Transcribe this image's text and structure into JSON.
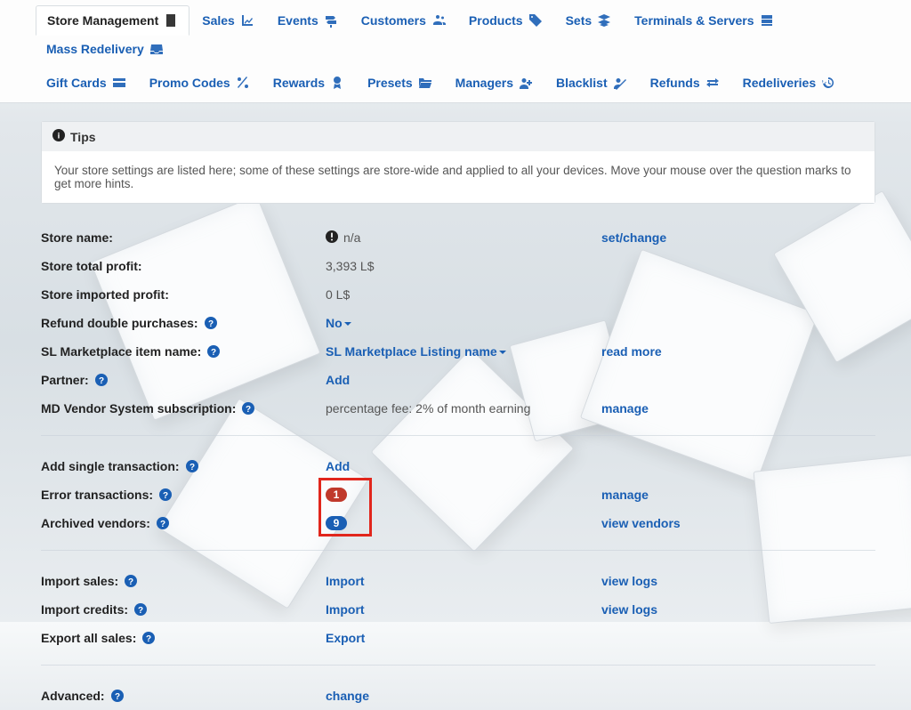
{
  "nav": {
    "row1": [
      {
        "label": "Store Management",
        "active": true
      },
      {
        "label": "Sales"
      },
      {
        "label": "Events"
      },
      {
        "label": "Customers"
      },
      {
        "label": "Products"
      },
      {
        "label": "Sets"
      },
      {
        "label": "Terminals & Servers"
      },
      {
        "label": "Mass Redelivery"
      }
    ],
    "row2": [
      {
        "label": "Gift Cards"
      },
      {
        "label": "Promo Codes"
      },
      {
        "label": "Rewards"
      },
      {
        "label": "Presets"
      },
      {
        "label": "Managers"
      },
      {
        "label": "Blacklist"
      },
      {
        "label": "Refunds"
      },
      {
        "label": "Redeliveries"
      }
    ]
  },
  "tips": {
    "title": "Tips",
    "body": "Your store settings are listed here; some of these settings are store-wide and applied to all your devices. Move your mouse over the question marks to get more hints."
  },
  "settings": {
    "store_name": {
      "label": "Store name:",
      "value": "n/a",
      "action": "set/change"
    },
    "store_total_profit": {
      "label": "Store total profit:",
      "value": "3,393 L$"
    },
    "store_imported_profit": {
      "label": "Store imported profit:",
      "value": "0 L$"
    },
    "refund_double": {
      "label": "Refund double purchases:",
      "value": "No"
    },
    "sl_marketplace": {
      "label": "SL Marketplace item name:",
      "value": "SL Marketplace Listing name",
      "action": "read more"
    },
    "partner": {
      "label": "Partner:",
      "value": "Add"
    },
    "subscription": {
      "label": "MD Vendor System subscription:",
      "value": "percentage fee: 2% of month earning",
      "action": "manage"
    },
    "add_single_tx": {
      "label": "Add single transaction:",
      "value": "Add"
    },
    "error_tx": {
      "label": "Error transactions:",
      "badge": "1",
      "action": "manage"
    },
    "archived_vendors": {
      "label": "Archived vendors:",
      "badge": "9",
      "action": "view vendors"
    },
    "import_sales": {
      "label": "Import sales:",
      "value": "Import",
      "action": "view logs"
    },
    "import_credits": {
      "label": "Import credits:",
      "value": "Import",
      "action": "view logs"
    },
    "export_all": {
      "label": "Export all sales:",
      "value": "Export"
    },
    "advanced": {
      "label": "Advanced:",
      "value": "change"
    }
  }
}
